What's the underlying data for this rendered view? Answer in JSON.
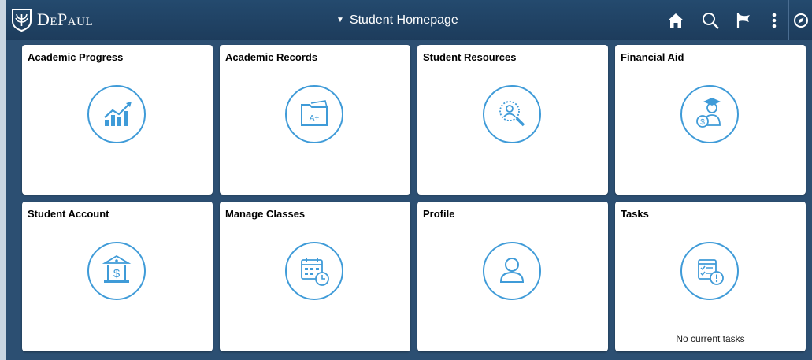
{
  "header": {
    "logo_text": "DePaul",
    "page_title": "Student Homepage",
    "icons": [
      "home-icon",
      "search-icon",
      "flag-icon",
      "more-icon",
      "navbar-icon"
    ]
  },
  "colors": {
    "header_bg": "#1f4264",
    "page_bg": "#2c4f72",
    "icon_blue": "#3f9bd8"
  },
  "tiles": [
    {
      "title": "Academic Progress",
      "icon": "growth-chart-icon"
    },
    {
      "title": "Academic Records",
      "icon": "folder-grade-icon"
    },
    {
      "title": "Student Resources",
      "icon": "person-search-icon"
    },
    {
      "title": "Financial Aid",
      "icon": "graduate-money-icon"
    },
    {
      "title": "Student Account",
      "icon": "bank-dollar-icon"
    },
    {
      "title": "Manage Classes",
      "icon": "calendar-clock-icon"
    },
    {
      "title": "Profile",
      "icon": "person-icon"
    },
    {
      "title": "Tasks",
      "icon": "tasks-alert-icon",
      "note": "No current tasks"
    }
  ]
}
